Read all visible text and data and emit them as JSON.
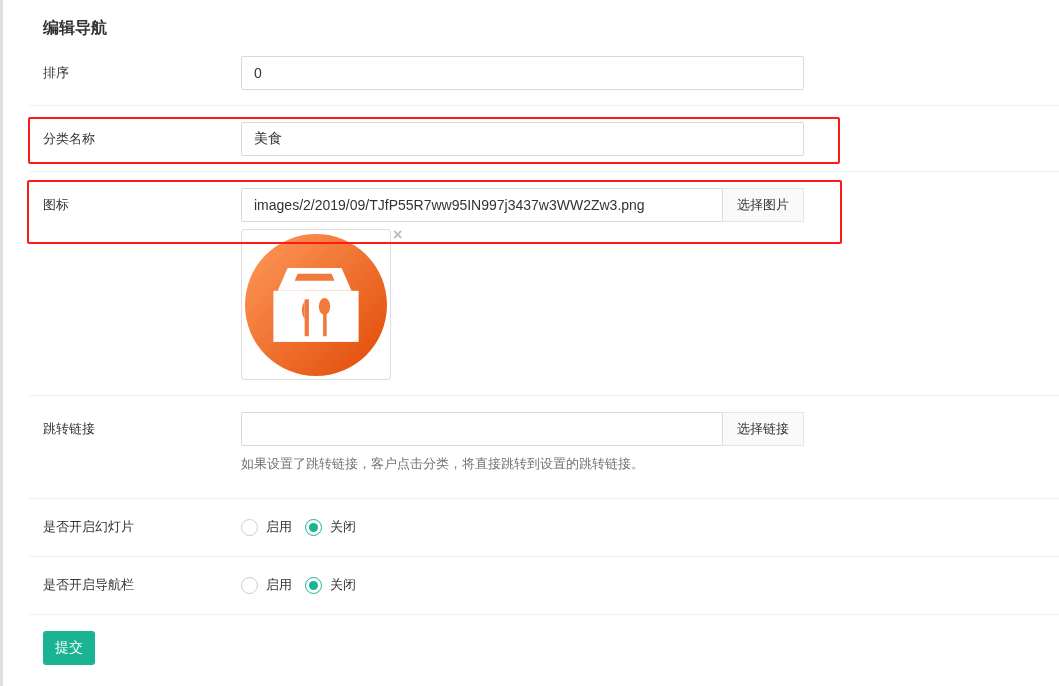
{
  "title": "编辑导航",
  "fields": [
    {
      "kind": "text",
      "label": "排序",
      "value": "0",
      "highlighted": false
    },
    {
      "kind": "text",
      "label": "分类名称",
      "value": "美食",
      "highlighted": true
    },
    {
      "kind": "image",
      "label": "图标",
      "value": "images/2/2019/09/TJfP55R7ww95IN997j3437w3WW2Zw3.png",
      "button": "选择图片",
      "remove": "×",
      "highlighted": true
    },
    {
      "kind": "link",
      "label": "跳转链接",
      "button": "选择链接",
      "help": "如果设置了跳转链接，客户点击分类，将直接跳转到设置的跳转链接。",
      "highlighted": false
    },
    {
      "kind": "radio",
      "label": "是否开启幻灯片",
      "options": [
        {
          "label": "启用",
          "selected": false
        },
        {
          "label": "关闭",
          "selected": true
        }
      ]
    },
    {
      "kind": "radio",
      "label": "是否开启导航栏",
      "options": [
        {
          "label": "启用",
          "selected": false
        },
        {
          "label": "关闭",
          "selected": true
        }
      ]
    }
  ],
  "submit": "提交"
}
